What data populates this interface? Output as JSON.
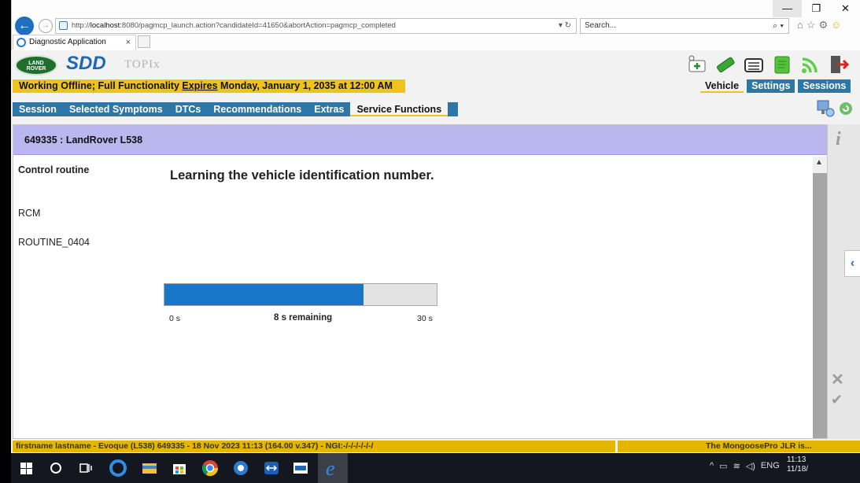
{
  "browser": {
    "url_prefix": "http://",
    "url_host": "localhost",
    "url_rest": ":8080/pagmcp_launch.action?candidateId=41650&abortAction=pagmcp_completed",
    "search_placeholder": "Search...",
    "tab_title": "Diagnostic Application"
  },
  "app": {
    "logo_text": "LAND ROVER",
    "brand": "SDD",
    "topix": "TOPIx",
    "status_pre": "Working Offline; Full Functionality ",
    "status_expires": "Expires",
    "status_post": " Monday, January 1, 2035 at 12:00 AM",
    "right_tabs": [
      "Vehicle",
      "Settings",
      "Sessions"
    ],
    "nav": [
      "Session",
      "Selected Symptoms",
      "DTCs",
      "Recommendations",
      "Extras",
      "Service Functions"
    ],
    "vehicle_title": "649335 : LandRover L538",
    "control_routine_label": "Control routine",
    "module": "RCM",
    "routine": "ROUTINE_0404",
    "heading": "Learning the vehicle identification number.",
    "progress": {
      "fraction": 0.73,
      "start_label": "0 s",
      "remaining_label": "8 s remaining",
      "end_label": "30 s"
    },
    "footer_left": "firstname lastname - Evoque (L538) 649335 - 18 Nov 2023 11:13 (164.00 v.347) - NGI:-/-/-/-/-/-/",
    "footer_right": "The MongoosePro JLR is..."
  },
  "colors": {
    "accent_yellow": "#f0c21c",
    "nav_blue": "#2d77a8",
    "progress_blue": "#1a76c9",
    "vehicle_bar": "#bab7ef"
  },
  "taskbar": {
    "time": "11:13",
    "date": "11/18/",
    "lang": "ENG"
  }
}
